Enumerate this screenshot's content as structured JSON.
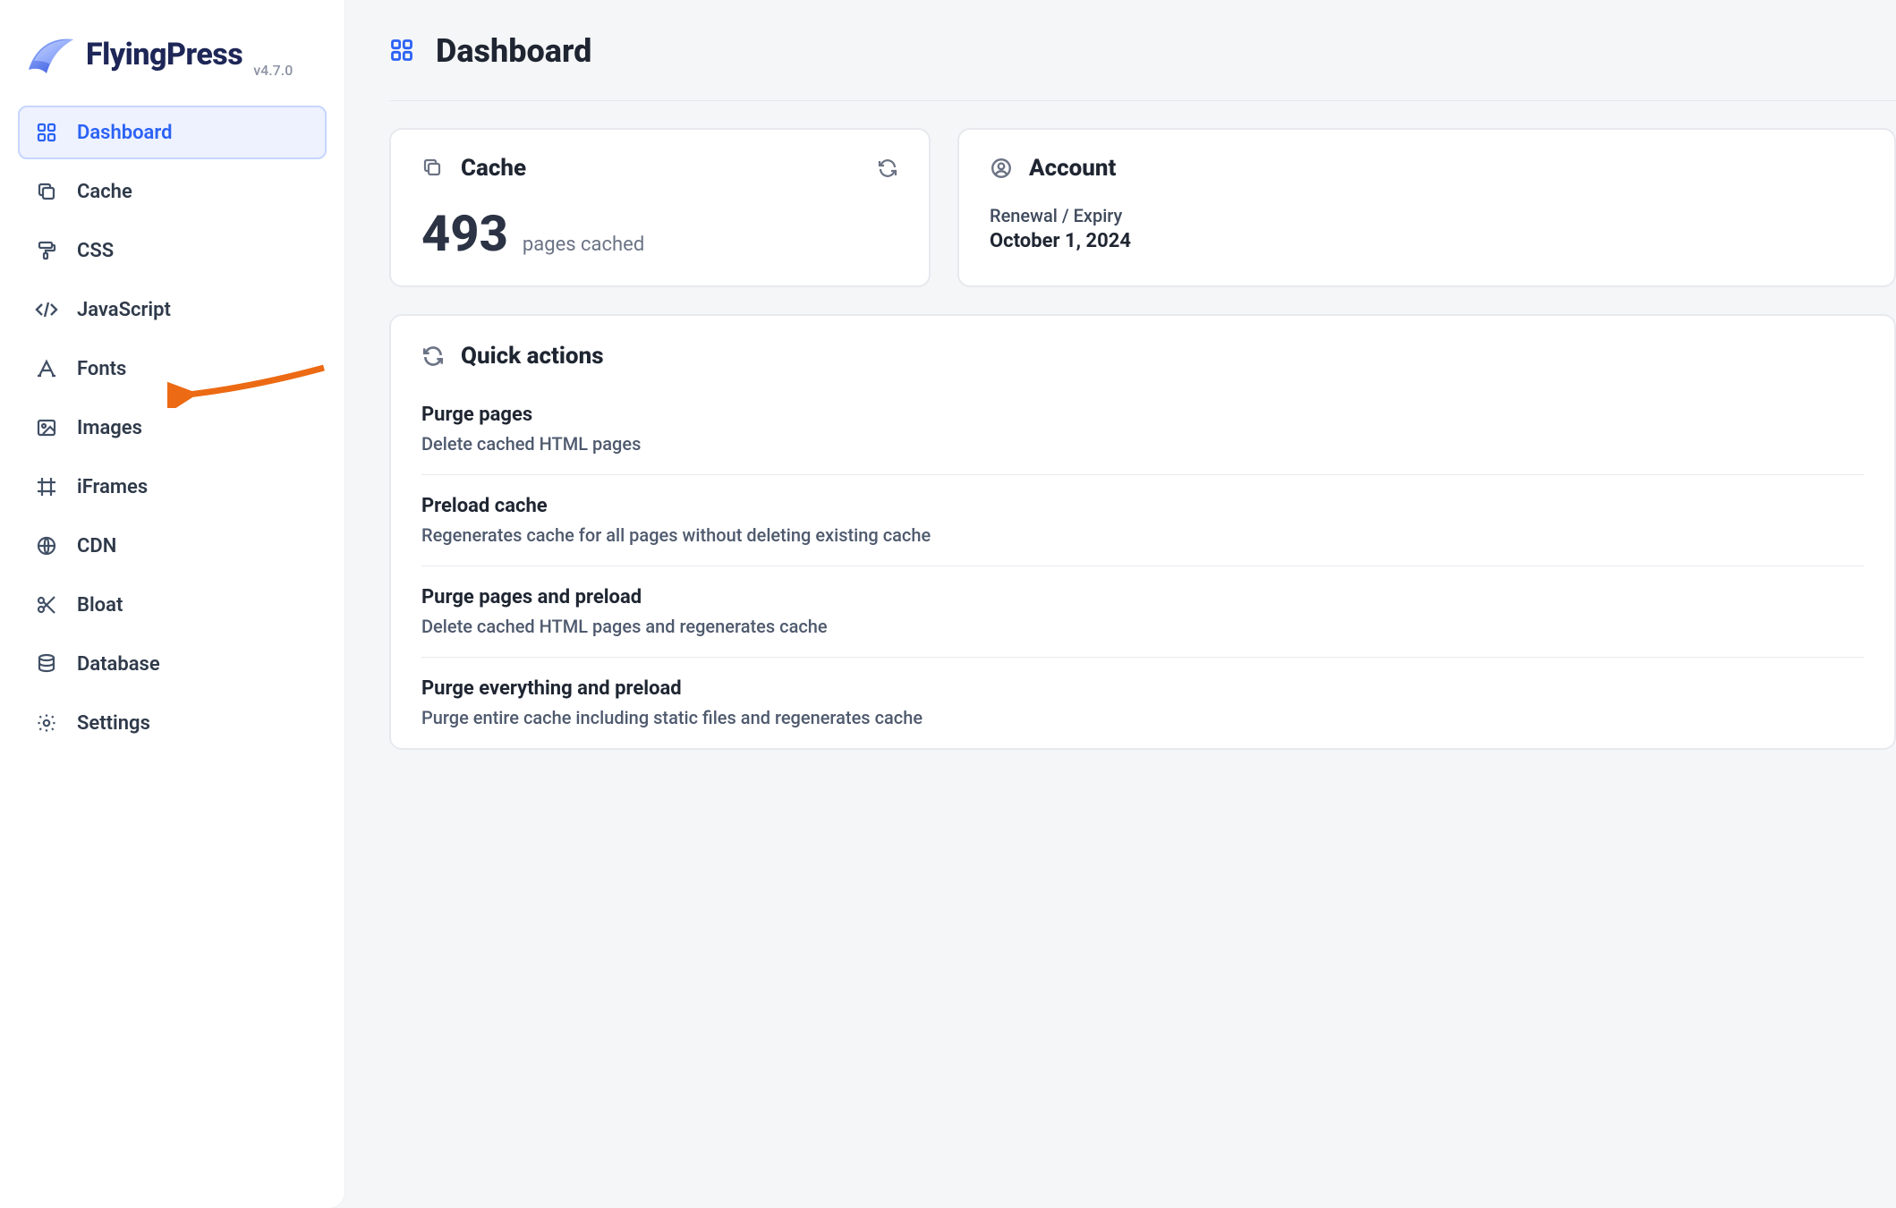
{
  "brand": {
    "name": "FlyingPress",
    "version": "v4.7.0"
  },
  "sidebar": {
    "items": [
      {
        "label": "Dashboard",
        "icon": "grid-icon",
        "active": true
      },
      {
        "label": "Cache",
        "icon": "copy-icon",
        "active": false
      },
      {
        "label": "CSS",
        "icon": "paint-icon",
        "active": false
      },
      {
        "label": "JavaScript",
        "icon": "code-icon",
        "active": false
      },
      {
        "label": "Fonts",
        "icon": "font-icon",
        "active": false
      },
      {
        "label": "Images",
        "icon": "image-icon",
        "active": false
      },
      {
        "label": "iFrames",
        "icon": "frame-icon",
        "active": false
      },
      {
        "label": "CDN",
        "icon": "globe-icon",
        "active": false
      },
      {
        "label": "Bloat",
        "icon": "scissors-icon",
        "active": false
      },
      {
        "label": "Database",
        "icon": "database-icon",
        "active": false
      },
      {
        "label": "Settings",
        "icon": "gear-icon",
        "active": false
      }
    ]
  },
  "page": {
    "title": "Dashboard"
  },
  "cache_card": {
    "title": "Cache",
    "count": "493",
    "count_label": "pages cached"
  },
  "account_card": {
    "title": "Account",
    "sub_label": "Renewal / Expiry",
    "sub_value": "October 1, 2024"
  },
  "quick": {
    "title": "Quick actions",
    "items": [
      {
        "title": "Purge pages",
        "desc": "Delete cached HTML pages"
      },
      {
        "title": "Preload cache",
        "desc": "Regenerates cache for all pages without deleting existing cache"
      },
      {
        "title": "Purge pages and preload",
        "desc": "Delete cached HTML pages and regenerates cache"
      },
      {
        "title": "Purge everything and preload",
        "desc": "Purge entire cache including static files and regenerates cache"
      }
    ]
  }
}
